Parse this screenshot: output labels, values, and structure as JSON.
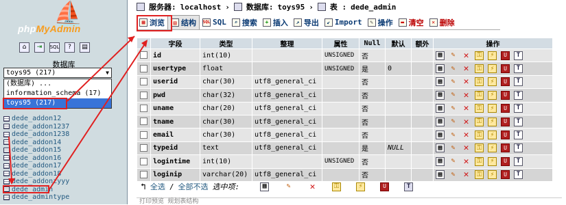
{
  "left": {
    "logo_main": "php",
    "logo_accent": "MyAdmin",
    "icons": [
      "home-icon",
      "exit-icon",
      "sql-icon",
      "query-icon",
      "docs-icon"
    ],
    "db_heading": "数据库",
    "db_select_value": "toys95 (217)",
    "db_options": [
      "(数据库) ...",
      "information_schema (17)",
      "toys95 (217)"
    ],
    "tables": [
      "dede_addon12",
      "dede_addon1237",
      "dede_addon1238",
      "dede_addon14",
      "dede_addon15",
      "dede_addon16",
      "dede_addon17",
      "dede_addon18",
      "dede_addonzyyy",
      "dede_admin",
      "dede_admintype"
    ]
  },
  "breadcrumb": {
    "server_label": "服务器:",
    "server": "localhost",
    "db_label": "数据库:",
    "db": "toys95",
    "table_label": "表 :",
    "table": "dede_admin"
  },
  "tabs": [
    "浏览",
    "结构",
    "SQL",
    "搜索",
    "插入",
    "导出",
    "Import",
    "操作",
    "清空",
    "删除"
  ],
  "grid": {
    "headers": [
      "字段",
      "类型",
      "整理",
      "属性",
      "Null",
      "默认",
      "额外",
      "操作"
    ],
    "rows": [
      {
        "field": "id",
        "type": "int(10)",
        "collation": "",
        "attr": "UNSIGNED",
        "null": "否",
        "default": "",
        "extra": ""
      },
      {
        "field": "usertype",
        "type": "float",
        "collation": "",
        "attr": "UNSIGNED",
        "null": "是",
        "default": "0",
        "extra": ""
      },
      {
        "field": "userid",
        "type": "char(30)",
        "collation": "utf8_general_ci",
        "attr": "",
        "null": "否",
        "default": "",
        "extra": ""
      },
      {
        "field": "pwd",
        "type": "char(32)",
        "collation": "utf8_general_ci",
        "attr": "",
        "null": "否",
        "default": "",
        "extra": ""
      },
      {
        "field": "uname",
        "type": "char(20)",
        "collation": "utf8_general_ci",
        "attr": "",
        "null": "否",
        "default": "",
        "extra": ""
      },
      {
        "field": "tname",
        "type": "char(30)",
        "collation": "utf8_general_ci",
        "attr": "",
        "null": "否",
        "default": "",
        "extra": ""
      },
      {
        "field": "email",
        "type": "char(30)",
        "collation": "utf8_general_ci",
        "attr": "",
        "null": "否",
        "default": "",
        "extra": ""
      },
      {
        "field": "typeid",
        "type": "text",
        "collation": "utf8_general_ci",
        "attr": "",
        "null": "是",
        "default": "NULL",
        "extra": ""
      },
      {
        "field": "logintime",
        "type": "int(10)",
        "collation": "",
        "attr": "UNSIGNED",
        "null": "否",
        "default": "",
        "extra": ""
      },
      {
        "field": "loginip",
        "type": "varchar(20)",
        "collation": "utf8_general_ci",
        "attr": "",
        "null": "否",
        "default": "",
        "extra": ""
      }
    ]
  },
  "footer": {
    "check_all": "全选",
    "separator": "/",
    "uncheck_all": "全部不选",
    "with_selected": "选中项:"
  },
  "bottom_strip": "打印预览   规划表结构",
  "colors": {
    "highlight": "#e02020",
    "sidebar_bg": "#d0dce0",
    "header_bg": "#d3dce3"
  }
}
